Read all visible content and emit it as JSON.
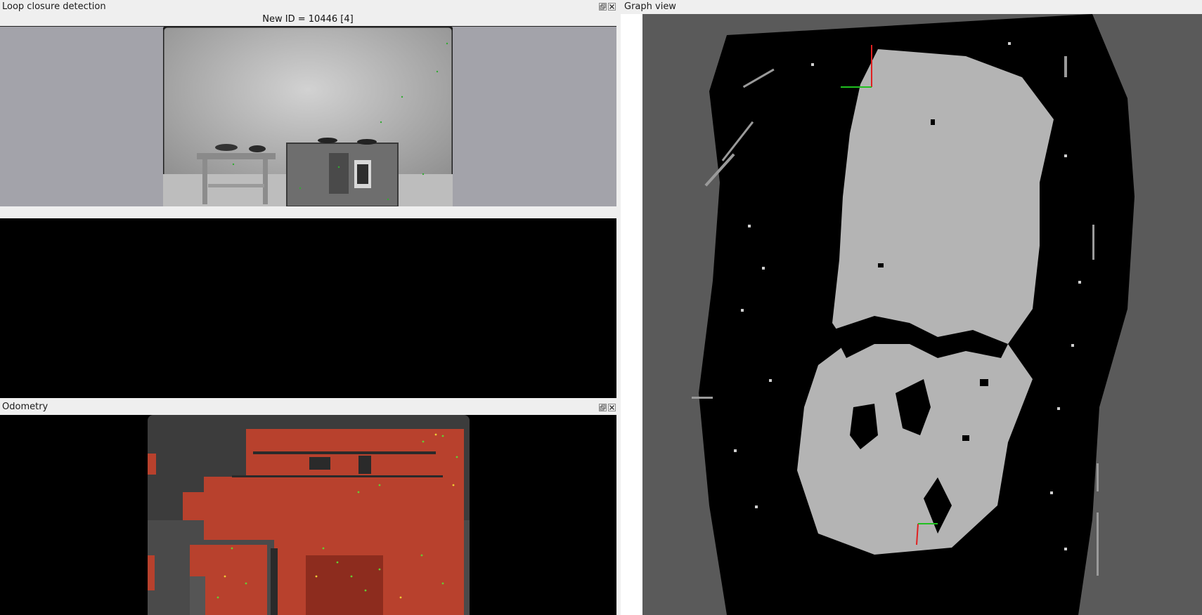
{
  "loop_closure": {
    "title": "Loop closure detection",
    "new_id_label": "New ID = 10446 [4]"
  },
  "odometry": {
    "title": "Odometry"
  },
  "graph_view": {
    "title": "Graph view"
  },
  "icons": {
    "float": "float-icon",
    "close": "close-icon"
  },
  "colors": {
    "panel_gray": "#a3a3aa",
    "map_free": "#b4b4b4",
    "map_unknown": "#5a5a5a",
    "map_occupied": "#000000",
    "odom_overlay": "#b8412d"
  }
}
